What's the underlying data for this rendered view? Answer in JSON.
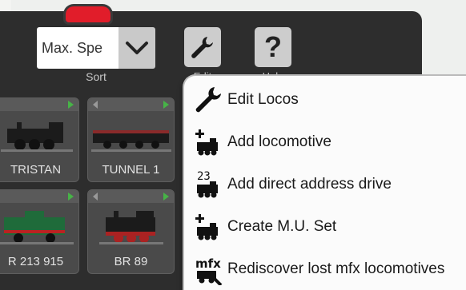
{
  "sort": {
    "value": "Max. Spe",
    "label": "Sort"
  },
  "toolbar": {
    "edit_label": "Edit",
    "help_label": "Help",
    "help_glyph": "?"
  },
  "tiles": [
    {
      "name": "TRISTAN",
      "color": "#2b2b2b"
    },
    {
      "name": "TUNNEL 1",
      "color": "#2b2b2b"
    },
    {
      "name": "R 213 915",
      "color": "#1f6b3a"
    },
    {
      "name": "BR 89",
      "color": "#222222"
    }
  ],
  "menu": {
    "items": [
      {
        "label": "Edit Locos",
        "icon": "wrench-icon"
      },
      {
        "label": "Add locomotive",
        "icon": "add-loco-icon"
      },
      {
        "label": "Add direct address drive",
        "icon": "direct-address-icon",
        "icon_digits": "23"
      },
      {
        "label": "Create M.U. Set",
        "icon": "mu-set-icon"
      },
      {
        "label": "Rediscover lost mfx locomotives",
        "icon": "mfx-icon",
        "icon_text": "mfx"
      }
    ]
  },
  "colors": {
    "panel": "#2d2d2d",
    "led": "#e11d2a",
    "accent_green": "#47b347"
  }
}
